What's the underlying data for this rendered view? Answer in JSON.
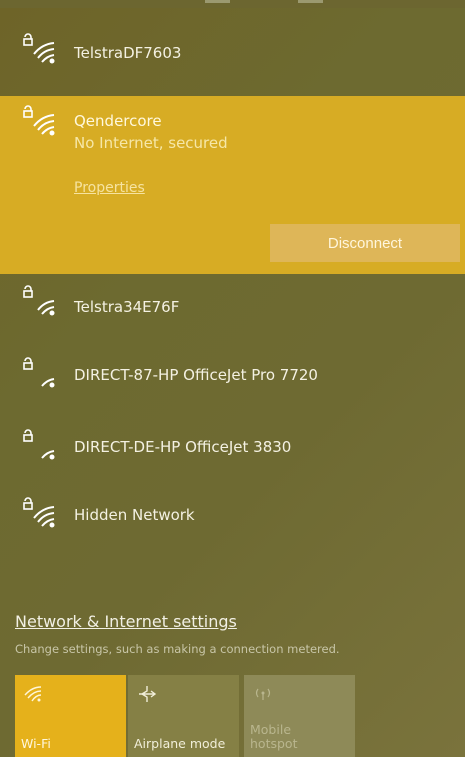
{
  "networks": [
    {
      "name": "TelstraDF7603"
    },
    {
      "name": "Qendercore",
      "status": "No Internet, secured",
      "properties_label": "Properties",
      "disconnect_label": "Disconnect"
    },
    {
      "name": "Telstra34E76F"
    },
    {
      "name": "DIRECT-87-HP OfficeJet Pro 7720"
    },
    {
      "name": "DIRECT-DE-HP OfficeJet 3830"
    },
    {
      "name": "Hidden Network"
    }
  ],
  "settings": {
    "title": "Network & Internet settings",
    "description": "Change settings, such as making a connection metered."
  },
  "quick_actions": {
    "wifi": {
      "label": "Wi-Fi",
      "icon": "wifi-icon",
      "state": "on"
    },
    "airplane": {
      "label": "Airplane mode",
      "icon": "airplane-icon",
      "state": "off"
    },
    "hotspot": {
      "label_line1": "Mobile",
      "label_line2": "hotspot",
      "icon": "hotspot-icon",
      "state": "disabled"
    }
  },
  "colors": {
    "accent": "#e5b11b",
    "selected_bg": "#d7ac24",
    "panel_bg": "#6e6a32"
  }
}
